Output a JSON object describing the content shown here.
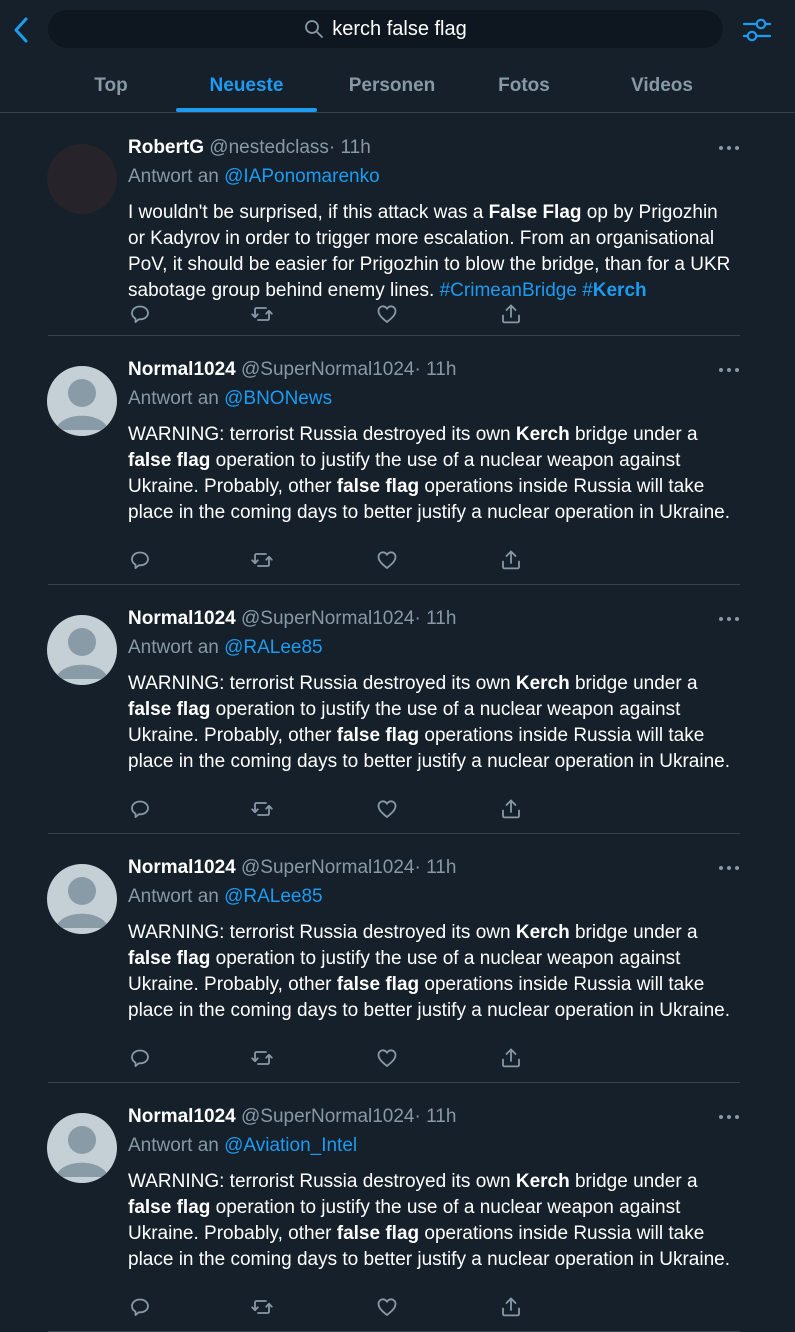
{
  "theme": {
    "background": "#15202b",
    "accent": "#1d9bf0",
    "muted": "#8899a6",
    "divider": "#38444d"
  },
  "search": {
    "query": "kerch false flag"
  },
  "tabs": [
    {
      "label": "Top"
    },
    {
      "label": "Neueste",
      "active": true
    },
    {
      "label": "Personen"
    },
    {
      "label": "Fotos"
    },
    {
      "label": "Videos"
    }
  ],
  "tweets": [
    {
      "name": "RobertG",
      "handle": "@nestedclass",
      "time": "· 11h",
      "reply_prefix": "Antwort an",
      "reply_to": "@IAPonomarenko",
      "body": [
        {
          "text": "I wouldn't be surprised, if this attack was a "
        },
        {
          "text": "False Flag",
          "bold": true
        },
        {
          "text": " op by Prigozhin or Kadyrov in order to trigger more escalation. From an organisational PoV, it should be easier for Prigozhin to blow the bridge, than for a UKR sabotage group behind enemy lines. "
        },
        {
          "text": "#CrimeanBridge",
          "link": true
        },
        {
          "text": " "
        },
        {
          "text": "#",
          "link": true
        },
        {
          "text": "Kerch",
          "link": true,
          "bold": true
        }
      ]
    },
    {
      "name": "Normal1024",
      "handle": "@SuperNormal1024",
      "time": "· 11h",
      "reply_prefix": "Antwort an",
      "reply_to": "@BNONews",
      "body": [
        {
          "text": "WARNING: terrorist Russia destroyed its own "
        },
        {
          "text": "Kerch",
          "bold": true
        },
        {
          "text": " bridge under a "
        },
        {
          "text": "false flag",
          "bold": true
        },
        {
          "text": " operation to justify the use of a nuclear weapon against Ukraine. Probably, other "
        },
        {
          "text": "false flag",
          "bold": true
        },
        {
          "text": " operations inside Russia will take place in the coming days to better justify a nuclear operation in Ukraine."
        }
      ]
    },
    {
      "name": "Normal1024",
      "handle": "@SuperNormal1024",
      "time": "· 11h",
      "reply_prefix": "Antwort an",
      "reply_to": "@RALee85",
      "body": [
        {
          "text": "WARNING: terrorist Russia destroyed its own "
        },
        {
          "text": "Kerch",
          "bold": true
        },
        {
          "text": " bridge under a "
        },
        {
          "text": "false flag",
          "bold": true
        },
        {
          "text": " operation to justify the use of a nuclear weapon against Ukraine. Probably, other "
        },
        {
          "text": "false flag",
          "bold": true
        },
        {
          "text": " operations inside Russia will take place in the coming days to better justify a nuclear operation in Ukraine."
        }
      ]
    },
    {
      "name": "Normal1024",
      "handle": "@SuperNormal1024",
      "time": "· 11h",
      "reply_prefix": "Antwort an",
      "reply_to": "@RALee85",
      "body": [
        {
          "text": "WARNING: terrorist Russia destroyed its own "
        },
        {
          "text": "Kerch",
          "bold": true
        },
        {
          "text": " bridge under a "
        },
        {
          "text": "false flag",
          "bold": true
        },
        {
          "text": " operation to justify the use of a nuclear weapon against Ukraine. Probably, other "
        },
        {
          "text": "false flag",
          "bold": true
        },
        {
          "text": " operations inside Russia will take place in the coming days to better justify a nuclear operation in Ukraine."
        }
      ]
    },
    {
      "name": "Normal1024",
      "handle": "@SuperNormal1024",
      "time": "· 11h",
      "reply_prefix": "Antwort an",
      "reply_to": "@Aviation_Intel",
      "body": [
        {
          "text": "WARNING: terrorist Russia destroyed its own "
        },
        {
          "text": "Kerch",
          "bold": true
        },
        {
          "text": " bridge under a "
        },
        {
          "text": "false flag",
          "bold": true
        },
        {
          "text": " operation to justify the use of a nuclear weapon against Ukraine. Probably, other "
        },
        {
          "text": "false flag",
          "bold": true
        },
        {
          "text": " operations inside Russia will take place in the coming days to better justify a nuclear operation in Ukraine."
        }
      ]
    }
  ]
}
